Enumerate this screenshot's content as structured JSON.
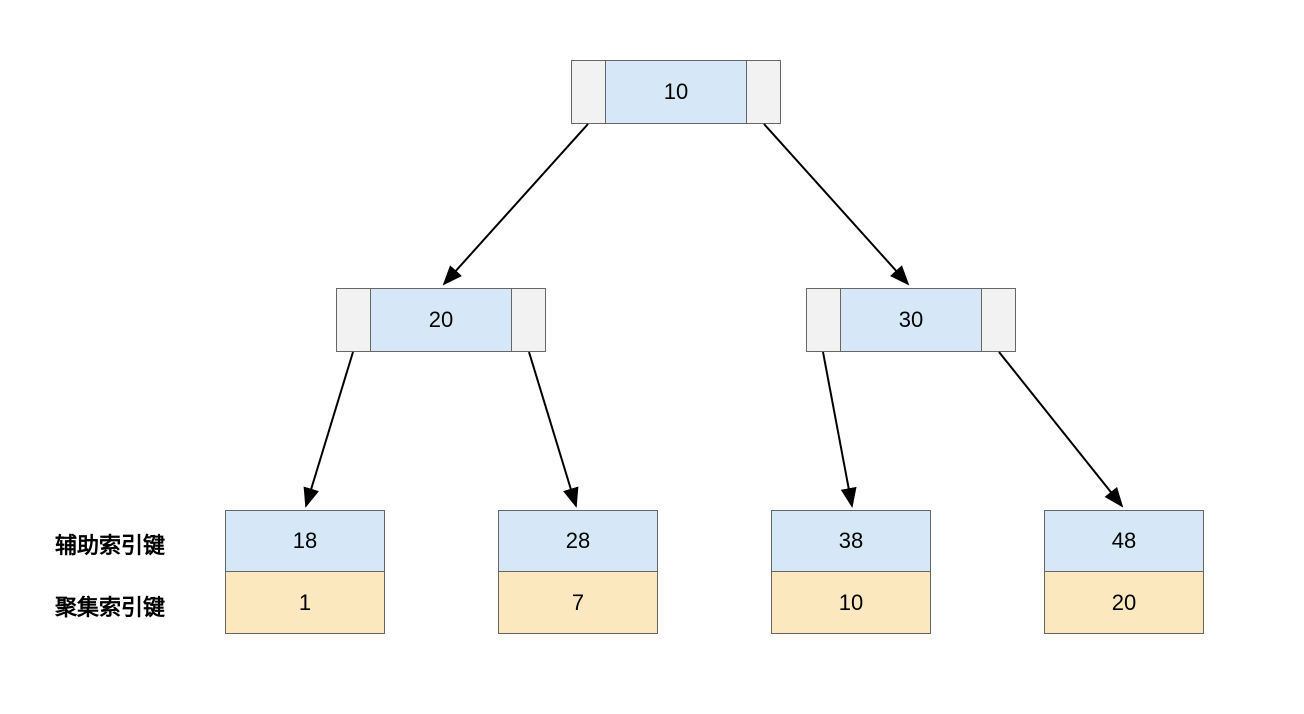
{
  "root": {
    "key": "10"
  },
  "mid_left": {
    "key": "20"
  },
  "mid_right": {
    "key": "30"
  },
  "leaves": [
    {
      "aux": "18",
      "clu": "1"
    },
    {
      "aux": "28",
      "clu": "7"
    },
    {
      "aux": "38",
      "clu": "10"
    },
    {
      "aux": "48",
      "clu": "20"
    }
  ],
  "labels": {
    "aux": "辅助索引键",
    "clu": "聚集索引键"
  },
  "colors": {
    "blue": "#d6e7f7",
    "yellow": "#fce8bf",
    "grey": "#f2f2f2"
  }
}
